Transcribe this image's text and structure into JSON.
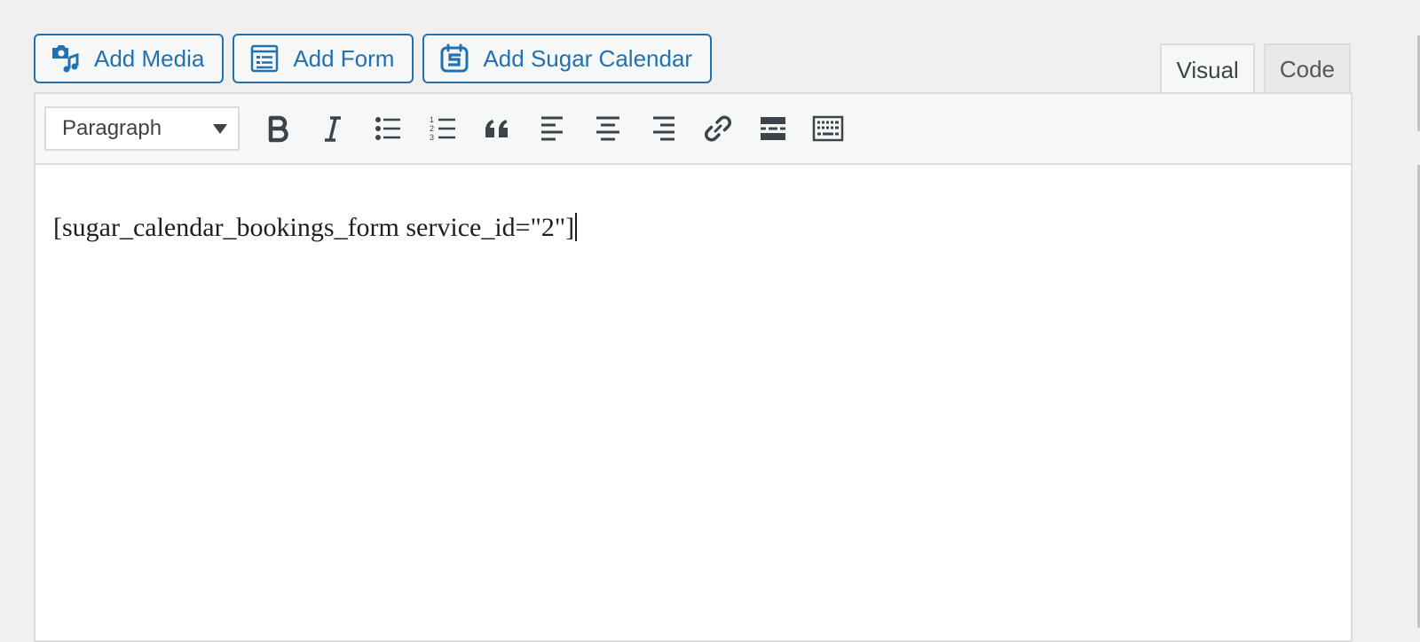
{
  "media_buttons": {
    "add_media": "Add Media",
    "add_form": "Add Form",
    "add_sugar_calendar": "Add Sugar Calendar"
  },
  "tabs": {
    "visual": "Visual",
    "code": "Code",
    "active": "visual"
  },
  "toolbar": {
    "format_select": "Paragraph",
    "buttons": [
      "bold",
      "italic",
      "bulleted-list",
      "numbered-list",
      "blockquote",
      "align-left",
      "align-center",
      "align-right",
      "insert-link",
      "read-more",
      "toolbar-toggle"
    ]
  },
  "editor": {
    "content": "[sugar_calendar_bookings_form service_id=\"2\"]"
  },
  "colors": {
    "accent": "#2271b1",
    "background": "#f0f0f1",
    "toolbar_bg": "#f6f7f7",
    "border": "#dcdcde",
    "icon": "#3c434a"
  }
}
